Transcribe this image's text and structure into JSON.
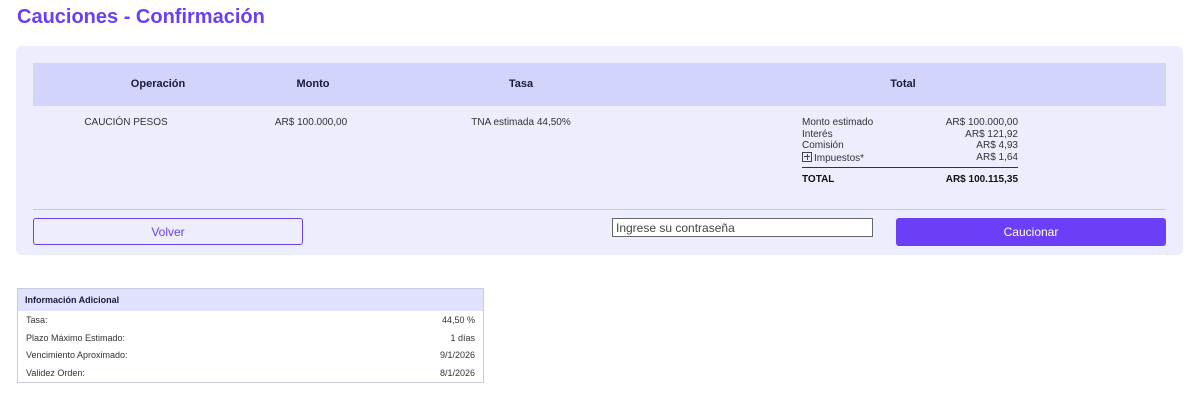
{
  "page": {
    "title": "Cauciones - Confirmación"
  },
  "colors": {
    "accent": "#6a3ff5",
    "card_bg": "#ecedfd",
    "header_bg": "#d3d4fb"
  },
  "table": {
    "headers": {
      "operacion": "Operación",
      "monto": "Monto",
      "tasa": "Tasa",
      "total": "Total"
    },
    "row": {
      "operacion": "CAUCIÓN PESOS",
      "monto": "AR$ 100.000,00",
      "tasa": "TNA estimada 44,50%"
    }
  },
  "summary": {
    "items": [
      {
        "label": "Monto estimado",
        "value": "AR$ 100.000,00"
      },
      {
        "label": "Interés",
        "value": "AR$ 121,92"
      },
      {
        "label": "Comisión",
        "value": "AR$ 4,93"
      },
      {
        "label": "Impuestos*",
        "value": "AR$ 1,64",
        "icon": "plus-box-icon"
      }
    ],
    "total_label": "TOTAL",
    "total_value": "AR$ 100.115,35"
  },
  "actions": {
    "back_label": "Volver",
    "password_placeholder": "Ingrese su contraseña",
    "password_value": "",
    "submit_label": "Caucionar"
  },
  "info": {
    "title": "Información Adicional",
    "rows": [
      {
        "label": "Tasa:",
        "value": "44,50 %"
      },
      {
        "label": "Plazo Máximo Estimado:",
        "value": "1 días"
      },
      {
        "label": "Vencimiento Aproximado:",
        "value": "9/1/2026"
      },
      {
        "label": "Validez Orden:",
        "value": "8/1/2026"
      }
    ]
  }
}
